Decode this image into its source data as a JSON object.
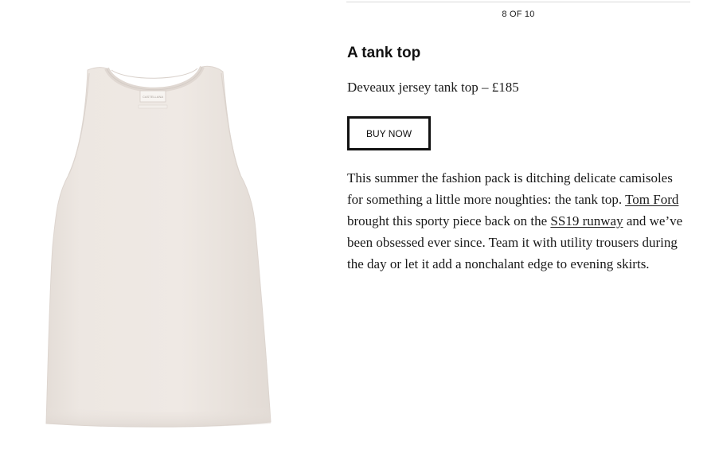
{
  "gallery": {
    "counter": "8 OF 10"
  },
  "product": {
    "image_alt": "cream jersey tank top",
    "label_text": "CASTELLANA",
    "title": "A tank top",
    "name_price": "Deveaux jersey tank top – £185",
    "buy_label": "BUY NOW"
  },
  "article": {
    "text_1": "This summer the fashion pack is ditching delicate camisoles for something a little more noughties: the tank top. ",
    "link_1": "Tom Ford",
    "text_2": " brought this sporty piece back on the ",
    "link_2": "SS19 runway",
    "text_3": " and we’ve been obsessed ever since. Team it with utility trousers during the day or let it add a nonchalant edge to evening skirts."
  },
  "colors": {
    "garment": "#ece6e1",
    "text": "#1a1a1a",
    "button_border": "#111111"
  }
}
